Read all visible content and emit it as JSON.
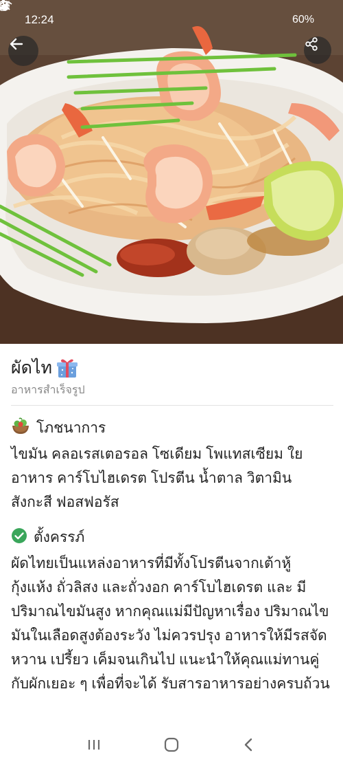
{
  "status_bar": {
    "time": "12:24",
    "battery": "60%",
    "icons": [
      "mute-vibrate-icon",
      "wifi-icon",
      "signal-icon",
      "battery-icon"
    ]
  },
  "hero": {
    "image": "pad-thai-with-shrimp-photo",
    "back_icon": "back-arrow-icon",
    "share_icon": "share-icon"
  },
  "dish": {
    "title": "ผัดไท",
    "title_icon": "gift-icon",
    "subtitle": "อาหารสำเร็จรูป"
  },
  "nutrition": {
    "icon": "salad-bowl-icon",
    "heading": "โภชนาการ",
    "text": "ไขมัน คลอเรสเตอรอล โซเดียม โพแทสเซียม ใยอาหาร คาร์โบไฮเดรต โปรตีน น้ำตาล วิตามิน สังกะสี ฟอสฟอรัส"
  },
  "pregnancy": {
    "icon": "check-circle-icon",
    "heading": "ตั้งครรภ์",
    "text": "ผัดไทยเป็นแหล่งอาหารที่มีทั้งโปรตีนจากเต้าหู้ กุ้งแห้ง ถั่วลิสง และถั่วงอก คาร์โบไฮเดรต และ มีปริมาณไขมันสูง หากคุณแม่มีปัญหาเรื่อง ปริมาณไขมันในเลือดสูงต้องระวัง ไม่ควรปรุง อาหารให้มีรสจัด หวาน เปรี้ยว เค็มจนเกินไป แนะนำให้คุณแม่ทานคู่กับผักเยอะ ๆ เพื่อที่จะได้ รับสารอาหารอย่างครบถ้วน"
  },
  "colors": {
    "accent_green": "#3aa65b",
    "text": "#222222",
    "subtle_text": "#888888",
    "nav_icon": "#6b6b6b"
  },
  "nav": {
    "recent_icon": "recent-apps-icon",
    "home_icon": "home-icon",
    "back_icon": "back-chevron-icon"
  }
}
